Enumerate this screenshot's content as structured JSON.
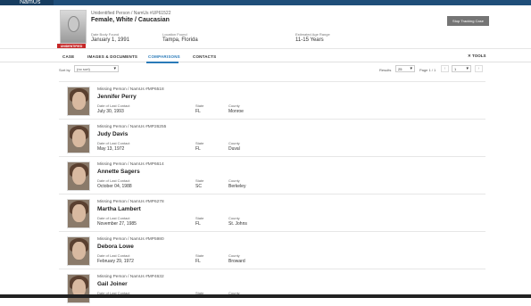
{
  "app": {
    "name": "NamUs"
  },
  "case": {
    "id_line": "Unidentified Person / NamUs #UP61522",
    "title": "Female, White / Caucasian",
    "badge": "UNIDENTIFIED",
    "fields": [
      {
        "label": "Date Body Found",
        "value": "January 1, 1991"
      },
      {
        "label": "Location Found",
        "value": "Tampa, Florida"
      },
      {
        "label": "Estimated Age Range",
        "value": "11-15 Years"
      }
    ],
    "track_button": "Stop Tracking Case"
  },
  "tabs": [
    "CASE",
    "IMAGES & DOCUMENTS",
    "COMPARISONS",
    "CONTACTS"
  ],
  "active_tab": "COMPARISONS",
  "tools_label": "TOOLS",
  "sort": {
    "label": "Sort by",
    "value": "(no sort)"
  },
  "pagination": {
    "results_label": "Results",
    "per_page": "25",
    "page_label": "Page 1 / 1",
    "prev": "‹",
    "page": "1",
    "next": "›"
  },
  "list_labels": {
    "date": "Date of Last Contact",
    "state": "State",
    "county": "County"
  },
  "matches": [
    {
      "id_line": "Missing Person / NamUs #MP6518",
      "name": "Jennifer Perry",
      "date": "July 30, 1993",
      "state": "FL",
      "county": "Monroe"
    },
    {
      "id_line": "Missing Person / NamUs #MP26255",
      "name": "Judy Davis",
      "date": "May 13, 1972",
      "state": "FL",
      "county": "Duval"
    },
    {
      "id_line": "Missing Person / NamUs #MP6614",
      "name": "Annette Sagers",
      "date": "October 04, 1988",
      "state": "SC",
      "county": "Berkeley"
    },
    {
      "id_line": "Missing Person / NamUs #MP6278",
      "name": "Martha Lambert",
      "date": "November 27, 1985",
      "state": "FL",
      "county": "St. Johns"
    },
    {
      "id_line": "Missing Person / NamUs #MP5980",
      "name": "Debora Lowe",
      "date": "February 29, 1972",
      "state": "FL",
      "county": "Broward"
    },
    {
      "id_line": "Missing Person / NamUs #MP4632",
      "name": "Gail Joiner",
      "date": "",
      "state": "",
      "county": ""
    }
  ]
}
